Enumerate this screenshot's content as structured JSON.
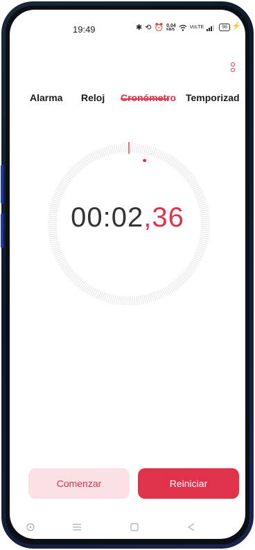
{
  "status_bar": {
    "time": "19:49",
    "icons": [
      "bluetooth-icon",
      "data-saver-icon",
      "alarm-icon",
      "speed-icon",
      "wifi-icon",
      "volte-icon",
      "signal-icon"
    ],
    "speed_value": "0.04",
    "speed_unit": "KB/S",
    "battery": "98",
    "charging": true
  },
  "tabs": [
    {
      "label": "Alarma",
      "active": false
    },
    {
      "label": "Reloj",
      "active": false
    },
    {
      "label": "Cronómetro",
      "active": true
    },
    {
      "label": "Temporizad",
      "active": false
    }
  ],
  "stopwatch": {
    "main": "00:02",
    "fraction": ",36"
  },
  "actions": {
    "start_label": "Comenzar",
    "reset_label": "Reiniciar"
  },
  "nav_bar": {
    "items": [
      "screenshot-icon",
      "menu-icon",
      "home-icon",
      "back-icon"
    ]
  },
  "colors": {
    "accent": "#e0324a",
    "accent_light": "#fbe0e4"
  }
}
